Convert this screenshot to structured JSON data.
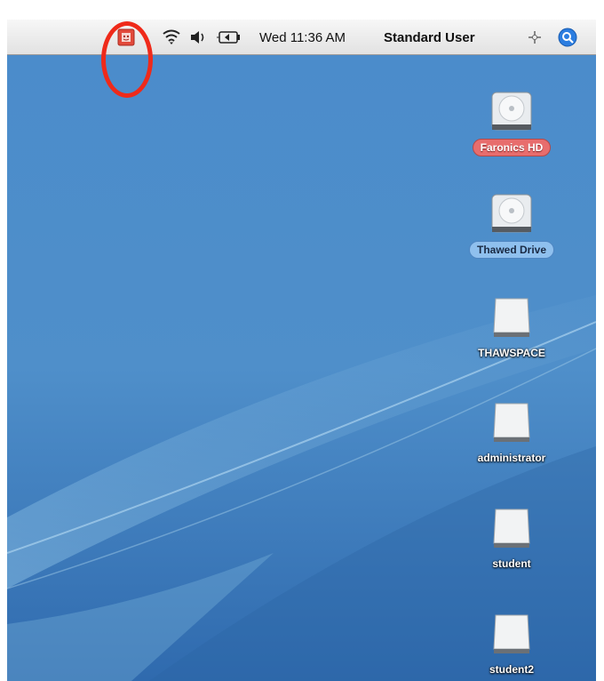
{
  "menubar": {
    "clock": "Wed 11:36 AM",
    "user": "Standard User",
    "icons": [
      "deep-freeze-icon",
      "wifi-icon",
      "volume-icon",
      "battery-icon",
      "user-switch-icon",
      "spotlight-icon"
    ]
  },
  "desktop": {
    "icons": [
      {
        "label": "Faronics HD",
        "style": "selected-red",
        "type": "hard-disk"
      },
      {
        "label": "Thawed Drive",
        "style": "selected-blue",
        "type": "hard-disk"
      },
      {
        "label": "THAWSPACE",
        "style": "plain",
        "type": "volume"
      },
      {
        "label": "administrator",
        "style": "plain",
        "type": "volume"
      },
      {
        "label": "student",
        "style": "plain",
        "type": "volume"
      },
      {
        "label": "student2",
        "style": "plain",
        "type": "volume"
      }
    ]
  },
  "annotation": {
    "color": "#ef2a1a",
    "shape": "ellipse"
  }
}
